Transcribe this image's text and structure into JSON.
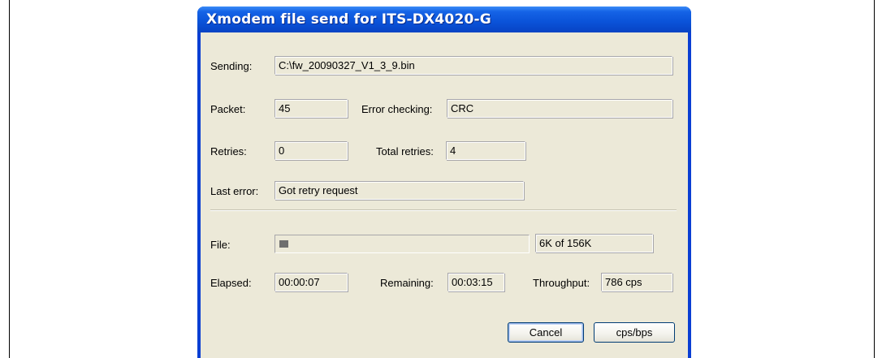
{
  "window": {
    "title": "Xmodem file send for ITS-DX4020-G"
  },
  "fields": {
    "sending_label": "Sending:",
    "sending_value": "C:\\fw_20090327_V1_3_9.bin",
    "packet_label": "Packet:",
    "packet_value": "45",
    "error_checking_label": "Error checking:",
    "error_checking_value": "CRC",
    "retries_label": "Retries:",
    "retries_value": "0",
    "total_retries_label": "Total retries:",
    "total_retries_value": "4",
    "last_error_label": "Last error:",
    "last_error_value": "Got retry request"
  },
  "transfer": {
    "file_label": "File:",
    "progress_fraction": 0.038,
    "file_size_text": "6K of 156K",
    "elapsed_label": "Elapsed:",
    "elapsed_value": "00:00:07",
    "remaining_label": "Remaining:",
    "remaining_value": "00:03:15",
    "throughput_label": "Throughput:",
    "throughput_value": "786 cps"
  },
  "buttons": {
    "cancel_label": "Cancel",
    "cps_bps_label": "cps/bps"
  }
}
